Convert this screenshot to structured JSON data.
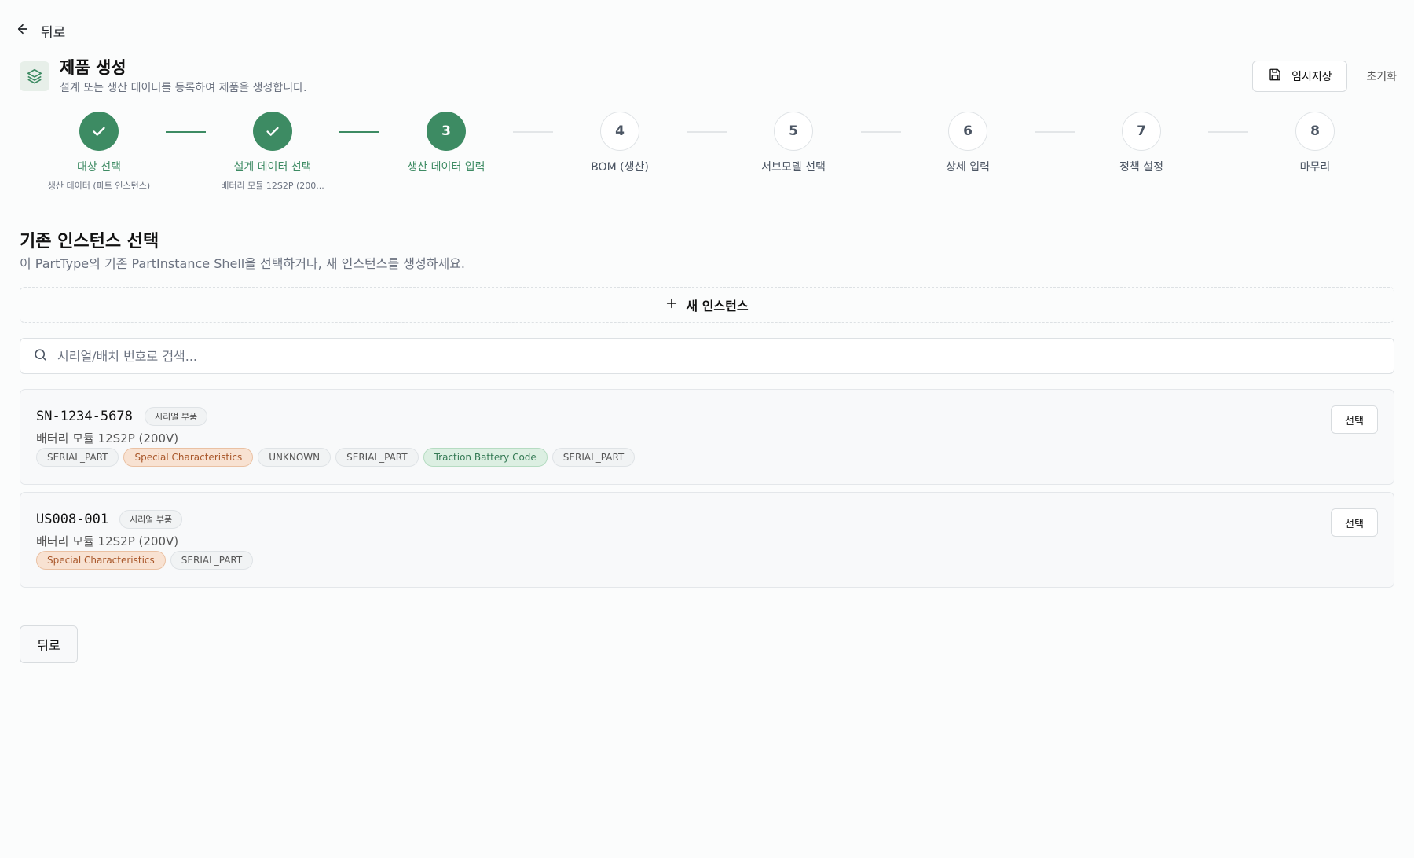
{
  "nav": {
    "back_label": "뒤로"
  },
  "header": {
    "title": "제품 생성",
    "subtitle": "설계 또는 생산 데이터를 등록하여 제품을 생성합니다.",
    "save_label": "임시저장",
    "reset_label": "초기화"
  },
  "stepper": {
    "steps": [
      {
        "number": "1",
        "label": "대상 선택",
        "sub": "생산 데이터 (파트 인스턴스)",
        "status": "done"
      },
      {
        "number": "2",
        "label": "설계 데이터 선택",
        "sub": "배터리 모듈 12S2P (200...",
        "status": "done"
      },
      {
        "number": "3",
        "label": "생산 데이터 입력",
        "status": "active"
      },
      {
        "number": "4",
        "label": "BOM (생산)",
        "status": "pending"
      },
      {
        "number": "5",
        "label": "서브모델 선택",
        "status": "pending"
      },
      {
        "number": "6",
        "label": "상세 입력",
        "status": "pending"
      },
      {
        "number": "7",
        "label": "정책 설정",
        "status": "pending"
      },
      {
        "number": "8",
        "label": "마무리",
        "status": "pending"
      }
    ]
  },
  "section": {
    "title": "기존 인스턴스 선택",
    "description": "이 PartType의 기존 PartInstance Shell을 선택하거나, 새 인스턴스를 생성하세요."
  },
  "new_instance": {
    "label": "새 인스턴스"
  },
  "search": {
    "placeholder": "시리얼/배치 번호로 검색..."
  },
  "instances": [
    {
      "serial": "SN-1234-5678",
      "type_badge": "시리얼 부품",
      "name": "배터리 모듈 12S2P (200V)",
      "select_label": "선택",
      "tags": [
        {
          "text": "SERIAL_PART",
          "style": "neutral"
        },
        {
          "text": "Special Characteristics",
          "style": "orange"
        },
        {
          "text": "UNKNOWN",
          "style": "neutral"
        },
        {
          "text": "SERIAL_PART",
          "style": "neutral"
        },
        {
          "text": "Traction Battery Code",
          "style": "green"
        },
        {
          "text": "SERIAL_PART",
          "style": "neutral"
        }
      ]
    },
    {
      "serial": "US008-001",
      "type_badge": "시리얼 부품",
      "name": "배터리 모듈 12S2P (200V)",
      "select_label": "선택",
      "tags": [
        {
          "text": "Special Characteristics",
          "style": "orange"
        },
        {
          "text": "SERIAL_PART",
          "style": "neutral"
        }
      ]
    }
  ],
  "footer": {
    "back_label": "뒤로"
  },
  "colors": {
    "accent": "#3d8b63",
    "tag_orange_bg": "#f8e2d2",
    "tag_green_bg": "#dcefe2"
  }
}
